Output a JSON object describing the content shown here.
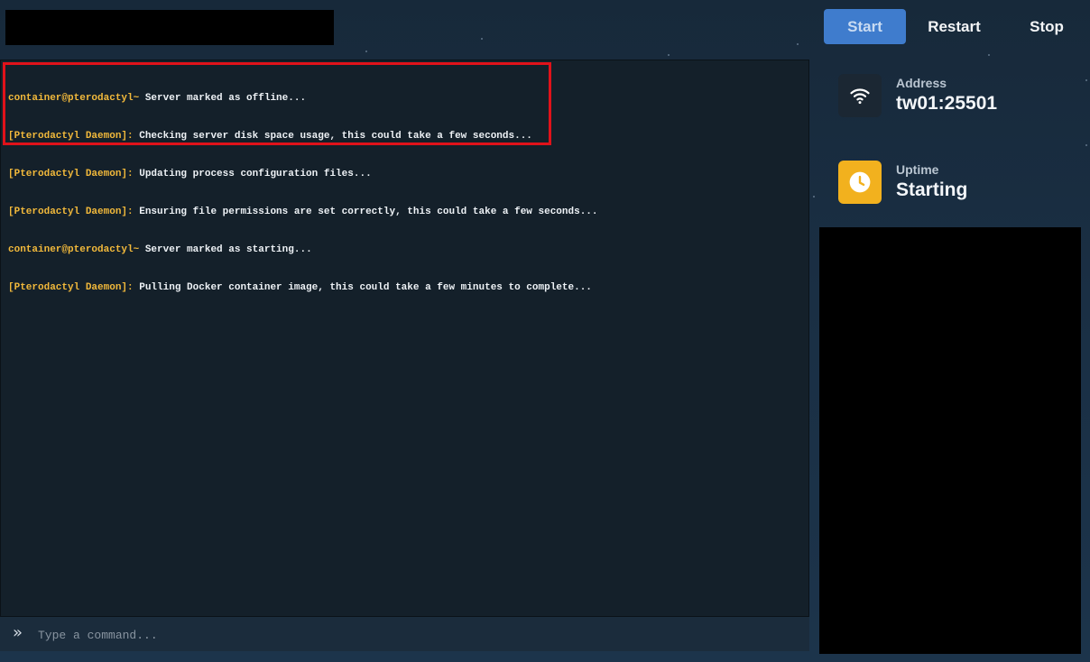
{
  "header": {
    "buttons": {
      "start": "Start",
      "restart": "Restart",
      "stop": "Stop"
    }
  },
  "console": {
    "lines": [
      {
        "prefix": "container@pterodactyl~",
        "message": " Server marked as offline..."
      },
      {
        "prefix": "[Pterodactyl Daemon]:",
        "message": " Checking server disk space usage, this could take a few seconds..."
      },
      {
        "prefix": "[Pterodactyl Daemon]:",
        "message": " Updating process configuration files..."
      },
      {
        "prefix": "[Pterodactyl Daemon]:",
        "message": " Ensuring file permissions are set correctly, this could take a few seconds..."
      },
      {
        "prefix": "container@pterodactyl~",
        "message": " Server marked as starting..."
      },
      {
        "prefix": "[Pterodactyl Daemon]:",
        "message": " Pulling Docker container image, this could take a few minutes to complete..."
      }
    ],
    "command_placeholder": "Type a command..."
  },
  "stats": {
    "address": {
      "label": "Address",
      "value": "tw01:25501",
      "icon": "wifi-icon"
    },
    "uptime": {
      "label": "Uptime",
      "value": "Starting",
      "icon": "clock-icon"
    }
  },
  "colors": {
    "accent_blue": "#3f7ccd",
    "uptime_yellow": "#f2b11e",
    "console_prefix": "#f2b93b",
    "highlight_red": "#e0121a"
  }
}
